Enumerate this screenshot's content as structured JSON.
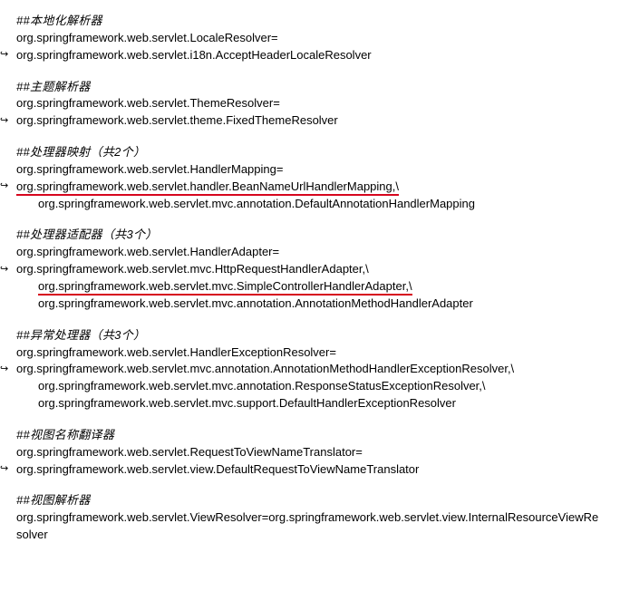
{
  "sections": [
    {
      "comment": "##本地化解析器",
      "lines": [
        {
          "text": "org.springframework.web.servlet.LocaleResolver=",
          "indent": 0,
          "cont": false,
          "underline": false
        },
        {
          "text": "org.springframework.web.servlet.i18n.AcceptHeaderLocaleResolver",
          "indent": 0,
          "cont": true,
          "underline": false
        }
      ]
    },
    {
      "comment": "##主题解析器",
      "lines": [
        {
          "text": "org.springframework.web.servlet.ThemeResolver=",
          "indent": 0,
          "cont": false,
          "underline": false
        },
        {
          "text": "org.springframework.web.servlet.theme.FixedThemeResolver",
          "indent": 0,
          "cont": true,
          "underline": false
        }
      ]
    },
    {
      "comment": "##处理器映射（共2个）",
      "lines": [
        {
          "text": "org.springframework.web.servlet.HandlerMapping=",
          "indent": 0,
          "cont": false,
          "underline": false
        },
        {
          "text": "org.springframework.web.servlet.handler.BeanNameUrlHandlerMapping,\\",
          "indent": 0,
          "cont": true,
          "underline": true
        },
        {
          "text": "org.springframework.web.servlet.mvc.annotation.DefaultAnnotationHandlerMapping",
          "indent": 1,
          "cont": false,
          "underline": false
        }
      ]
    },
    {
      "comment": "##处理器适配器（共3个）",
      "lines": [
        {
          "text": "org.springframework.web.servlet.HandlerAdapter=",
          "indent": 0,
          "cont": false,
          "underline": false
        },
        {
          "text": "org.springframework.web.servlet.mvc.HttpRequestHandlerAdapter,\\",
          "indent": 0,
          "cont": true,
          "underline": false
        },
        {
          "text": "org.springframework.web.servlet.mvc.SimpleControllerHandlerAdapter,\\",
          "indent": 1,
          "cont": false,
          "underline": true
        },
        {
          "text": "org.springframework.web.servlet.mvc.annotation.AnnotationMethodHandlerAdapter",
          "indent": 1,
          "cont": false,
          "underline": false
        }
      ]
    },
    {
      "comment": "##异常处理器（共3个）",
      "lines": [
        {
          "text": "org.springframework.web.servlet.HandlerExceptionResolver=",
          "indent": 0,
          "cont": false,
          "underline": false
        },
        {
          "text": "org.springframework.web.servlet.mvc.annotation.AnnotationMethodHandlerExceptionResolver,\\",
          "indent": 0,
          "cont": true,
          "underline": false
        },
        {
          "text": "org.springframework.web.servlet.mvc.annotation.ResponseStatusExceptionResolver,\\",
          "indent": 1,
          "cont": false,
          "underline": false
        },
        {
          "text": "org.springframework.web.servlet.mvc.support.DefaultHandlerExceptionResolver",
          "indent": 1,
          "cont": false,
          "underline": false
        }
      ]
    },
    {
      "comment": "##视图名称翻译器",
      "lines": [
        {
          "text": "org.springframework.web.servlet.RequestToViewNameTranslator=",
          "indent": 0,
          "cont": false,
          "underline": false
        },
        {
          "text": "org.springframework.web.servlet.view.DefaultRequestToViewNameTranslator",
          "indent": 0,
          "cont": true,
          "underline": false
        }
      ]
    },
    {
      "comment": "##视图解析器",
      "lines": [
        {
          "text": "org.springframework.web.servlet.ViewResolver=org.springframework.web.servlet.view.InternalResourceViewResolver",
          "indent": 0,
          "cont": false,
          "underline": false
        }
      ]
    }
  ],
  "cont_icon": "↪"
}
